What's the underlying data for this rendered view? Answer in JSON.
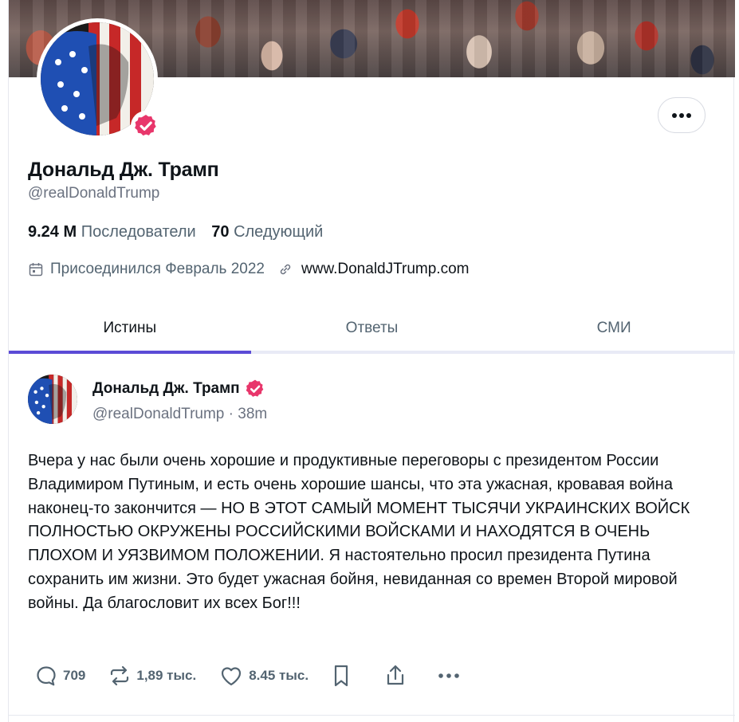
{
  "profile": {
    "name": "Дональд Дж. Трамп",
    "handle": "@realDonaldTrump",
    "followers_count": "9.24 M",
    "followers_label": "Последователи",
    "following_count": "70",
    "following_label": "Следующий",
    "joined": "Присоединился Февраль 2022",
    "website": "www.DonaldJTrump.com"
  },
  "tabs": [
    {
      "label": "Истины",
      "active": true
    },
    {
      "label": "Ответы",
      "active": false
    },
    {
      "label": "СМИ",
      "active": false
    }
  ],
  "post": {
    "author": "Дональд Дж. Трамп",
    "handle": "@realDonaldTrump",
    "time": "· 38m",
    "text": "Вчера у нас были очень хорошие и продуктивные переговоры с президентом России Владимиром Путиным, и есть очень хорошие шансы, что эта ужасная, кровавая война наконец-то закончится — НО В ЭТОТ САМЫЙ МОМЕНТ ТЫСЯЧИ УКРАИНСКИХ ВОЙСК ПОЛНОСТЬЮ ОКРУЖЕНЫ РОССИЙСКИМИ ВОЙСКАМИ И НАХОДЯТСЯ В ОЧЕНЬ ПЛОХОМ И УЯЗВИМОМ ПОЛОЖЕНИИ. Я настоятельно просил президента Путина сохранить им жизни. Это будет ужасная бойня, невиданная со времен Второй мировой войны. Да благословит их всех Бог!!!",
    "replies": "709",
    "retruths": "1,89 тыс.",
    "likes": "8.45 тыс."
  },
  "colors": {
    "accent": "#5b4bd6",
    "verified": "#e8366b",
    "muted": "#536471"
  },
  "icons": [
    "more-icon",
    "verified-icon",
    "calendar-icon",
    "link-icon",
    "reply-icon",
    "retruth-icon",
    "like-icon",
    "bookmark-icon",
    "share-icon"
  ]
}
